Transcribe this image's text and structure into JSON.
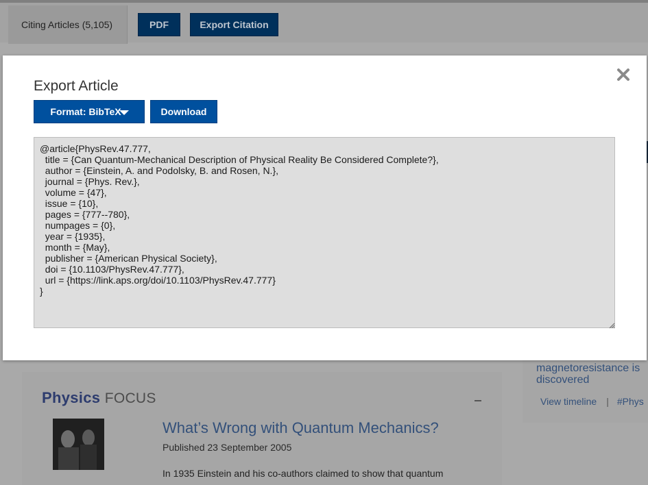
{
  "background": {
    "tabs": {
      "citing": "Citing Articles (5,105)"
    },
    "toolbar": {
      "pdf_label": "PDF",
      "export_label": "Export Citation"
    },
    "focus": {
      "logo_physics": "Physics",
      "logo_focus": "FOCUS",
      "article_title": "What’s Wrong with Quantum Mechanics?",
      "published": "Published 23 September 2005",
      "snippet": "In 1935 Einstein and his co-authors claimed to show that quantum"
    },
    "right_card": {
      "text_line1": "magnetoresistance is",
      "text_line2": "discovered",
      "view_timeline": "View timeline",
      "separator": "|",
      "hashtag": "#Phys"
    }
  },
  "modal": {
    "title": "Export Article",
    "format_label": "Format: BibTeX",
    "download_label": "Download",
    "close_icon": "close-icon",
    "bibtex": "@article{PhysRev.47.777,\n  title = {Can Quantum-Mechanical Description of Physical Reality Be Considered Complete?},\n  author = {Einstein, A. and Podolsky, B. and Rosen, N.},\n  journal = {Phys. Rev.},\n  volume = {47},\n  issue = {10},\n  pages = {777--780},\n  numpages = {0},\n  year = {1935},\n  month = {May},\n  publisher = {American Physical Society},\n  doi = {10.1103/PhysRev.47.777},\n  url = {https://link.aps.org/doi/10.1103/PhysRev.47.777}\n}"
  },
  "colors": {
    "accent": "#00509e",
    "overlay": "#a9a9a9",
    "link": "#33507a"
  }
}
